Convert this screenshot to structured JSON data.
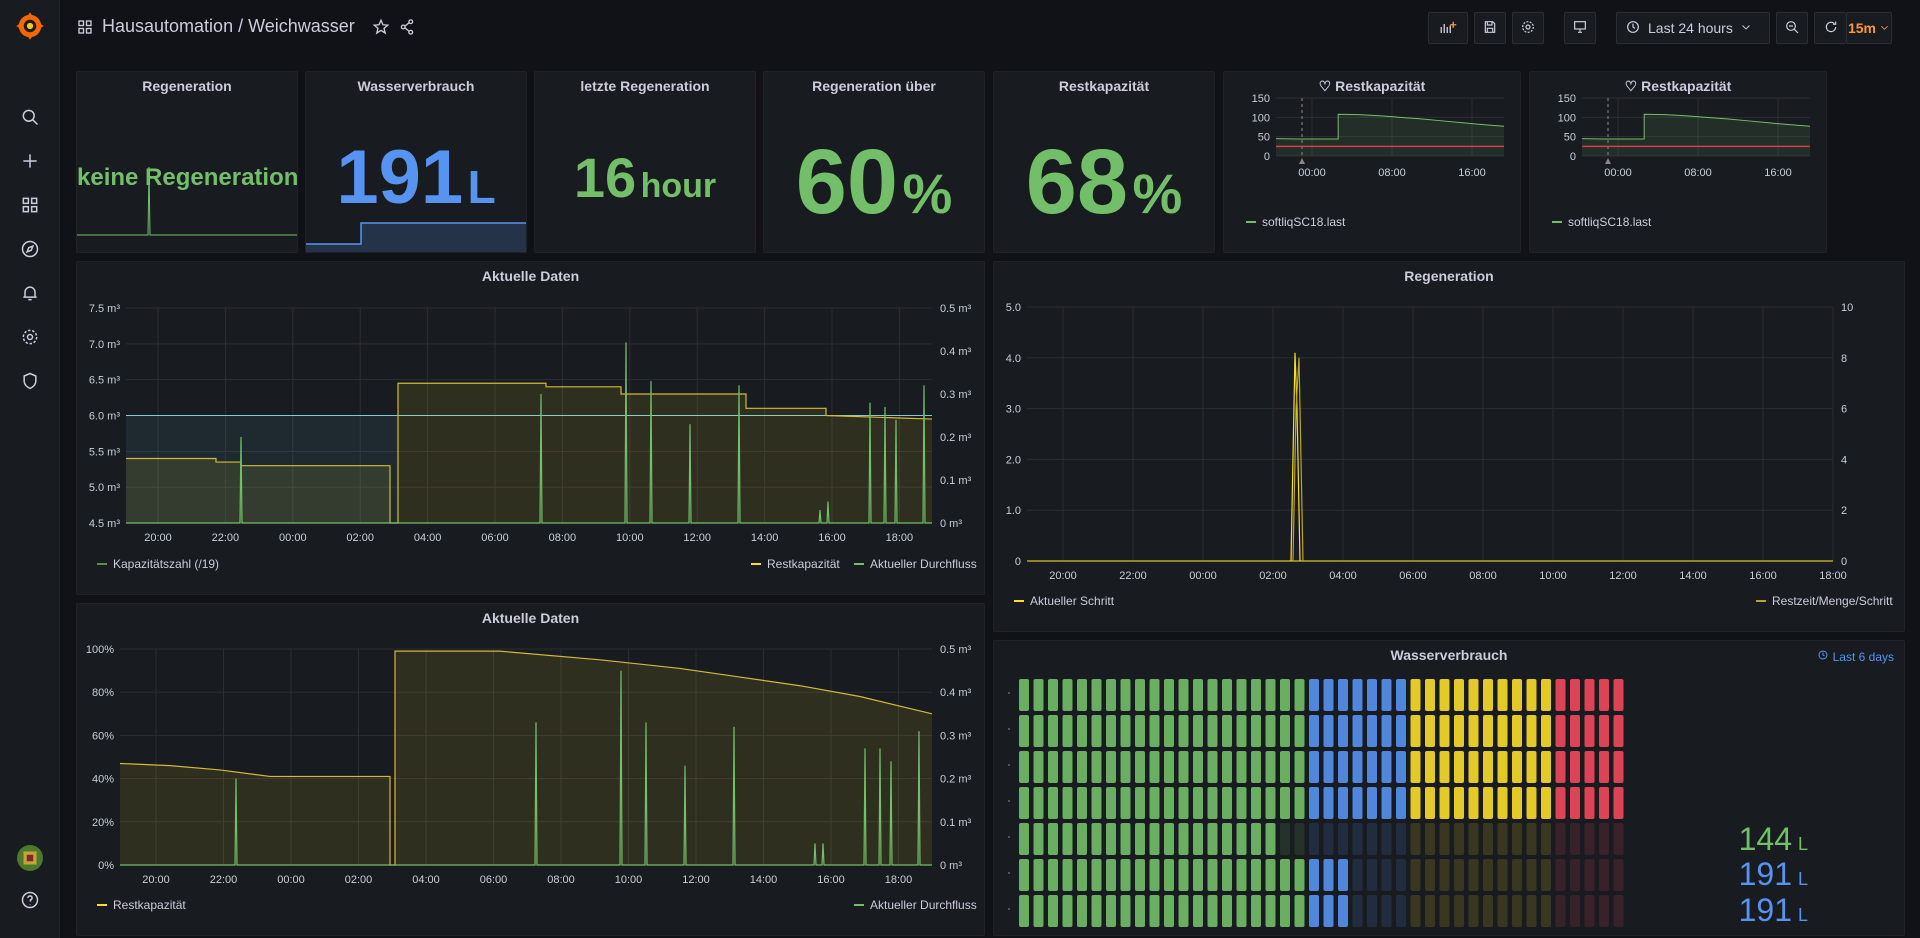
{
  "nav": {
    "breadcrumb": "Hausautomation / Weichwasser",
    "time_range": "Last 24 hours",
    "refresh": "15m"
  },
  "stats": {
    "regeneration": {
      "title": "Regeneration",
      "value": "keine Regeneration"
    },
    "wasserverbrauch": {
      "title": "Wasserverbrauch",
      "value": "191",
      "unit": "L"
    },
    "letzte": {
      "title": "letzte Regeneration",
      "value": "16",
      "unit": "hour"
    },
    "uber": {
      "title": "Regeneration über",
      "value": "60",
      "unit": "%"
    },
    "restkap": {
      "title": "Restkapazität",
      "value": "68",
      "unit": "%"
    }
  },
  "mini1": {
    "title": "Restkapazität",
    "legend": "softliqSC18.last"
  },
  "mini2": {
    "title": "Restkapazität",
    "legend": "softliqSC18.last"
  },
  "aktuelle1": {
    "title": "Aktuelle Daten",
    "legend_left": "Kapazitätszahl (/19)",
    "legend_r1": "Restkapazität",
    "legend_r2": "Aktueller Durchfluss"
  },
  "aktuelle2": {
    "title": "Aktuelle Daten",
    "legend_left": "Restkapazität",
    "legend_right": "Aktueller Durchfluss"
  },
  "regen": {
    "title": "Regeneration",
    "legend_left": "Aktueller Schritt",
    "legend_right": "Restzeit/Menge/Schritt"
  },
  "water": {
    "title": "Wasserverbrauch",
    "range": "Last 6 days",
    "rows": [
      {
        "value": "144",
        "unit": "L",
        "color": "#73bf69"
      },
      {
        "value": "191",
        "unit": "L",
        "color": "#5794f2"
      },
      {
        "value": "191",
        "unit": "L",
        "color": "#5794f2"
      }
    ]
  },
  "colors": {
    "green": "#73bf69",
    "blue": "#5794f2",
    "yellow": "#fade2a",
    "red": "#f2495c",
    "orange": "#ff9830"
  },
  "chart_data": [
    {
      "type": "line",
      "title": "Restkapazität",
      "x": [
        "00:00",
        "08:00",
        "16:00"
      ],
      "y_ticks": [
        0,
        50,
        100,
        150
      ],
      "ylim": [
        0,
        150
      ],
      "series": [
        {
          "name": "softliqSC18.last",
          "values": [
            45,
            44,
            44,
            108,
            107,
            104,
            100,
            96,
            91,
            86,
            81,
            77
          ]
        }
      ],
      "legend": "bottom-left"
    },
    {
      "type": "line",
      "title": "Restkapazität",
      "x": [
        "00:00",
        "08:00",
        "16:00"
      ],
      "y_ticks": [
        0,
        50,
        100,
        150
      ],
      "ylim": [
        0,
        150
      ],
      "series": [
        {
          "name": "softliqSC18.last",
          "values": [
            45,
            44,
            44,
            108,
            107,
            104,
            100,
            96,
            91,
            86,
            81,
            77
          ]
        }
      ],
      "legend": "bottom-left"
    },
    {
      "type": "line",
      "title": "Aktuelle Daten",
      "x": [
        "20:00",
        "22:00",
        "00:00",
        "02:00",
        "04:00",
        "06:00",
        "08:00",
        "10:00",
        "12:00",
        "14:00",
        "16:00",
        "18:00"
      ],
      "y_left_ticks": [
        "4.5 m³",
        "5.0 m³",
        "5.5 m³",
        "6.0 m³",
        "6.5 m³",
        "7.0 m³",
        "7.5 m³"
      ],
      "y_right_ticks": [
        "0 m³",
        "0.1 m³",
        "0.2 m³",
        "0.3 m³",
        "0.4 m³",
        "0.5 m³"
      ],
      "series": [
        {
          "name": "Kapazitätszahl (/19)",
          "values": [
            6.0,
            6.0,
            6.0,
            6.0,
            6.0,
            6.0,
            6.0,
            6.0,
            6.0,
            6.0,
            6.0,
            6.0
          ]
        },
        {
          "name": "Restkapazität",
          "values": [
            5.4,
            5.35,
            5.3,
            5.3,
            6.45,
            6.45,
            6.4,
            6.3,
            6.2,
            6.1,
            6.0,
            5.95
          ]
        },
        {
          "name": "Aktueller Durchfluss",
          "values": [
            0,
            0.2,
            0,
            0,
            0,
            0,
            0.3,
            0.42,
            0.33,
            0.32,
            0.28,
            0.33
          ]
        }
      ]
    },
    {
      "type": "line",
      "title": "Aktuelle Daten",
      "x": [
        "20:00",
        "22:00",
        "00:00",
        "02:00",
        "04:00",
        "06:00",
        "08:00",
        "10:00",
        "12:00",
        "14:00",
        "16:00",
        "18:00"
      ],
      "y_left_ticks": [
        "0%",
        "20%",
        "40%",
        "60%",
        "80%",
        "100%"
      ],
      "y_right_ticks": [
        "0 m³",
        "0.1 m³",
        "0.2 m³",
        "0.3 m³",
        "0.4 m³",
        "0.5 m³"
      ],
      "series": [
        {
          "name": "Restkapazität",
          "values": [
            47,
            46,
            44,
            41,
            99,
            99,
            98,
            95,
            91,
            87,
            83,
            78
          ]
        },
        {
          "name": "Aktueller Durchfluss",
          "values": [
            0,
            0.2,
            0,
            0,
            0,
            0,
            0.33,
            0.45,
            0.35,
            0.32,
            0.28,
            0.33
          ]
        }
      ]
    },
    {
      "type": "line",
      "title": "Regeneration",
      "x": [
        "20:00",
        "22:00",
        "00:00",
        "02:00",
        "04:00",
        "06:00",
        "08:00",
        "10:00",
        "12:00",
        "14:00",
        "16:00",
        "18:00"
      ],
      "y_left_ticks": [
        "0",
        "1.0",
        "2.0",
        "3.0",
        "4.0",
        "5.0"
      ],
      "y_right_ticks": [
        "0",
        "2",
        "4",
        "6",
        "8",
        "10"
      ],
      "series": [
        {
          "name": "Aktueller Schritt",
          "values": [
            0,
            0,
            0,
            0,
            4.1,
            0,
            0,
            0,
            0,
            0,
            0,
            0
          ]
        },
        {
          "name": "Restzeit/Menge/Schritt",
          "values": [
            0,
            0,
            0,
            0,
            8,
            0,
            0,
            0,
            0,
            0,
            0,
            0
          ]
        }
      ]
    }
  ]
}
